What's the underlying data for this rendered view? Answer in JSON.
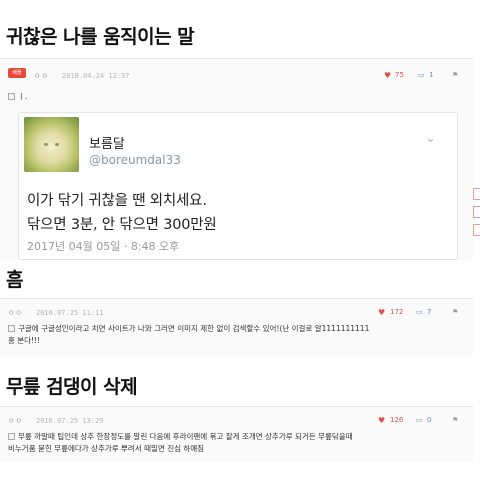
{
  "sections": [
    {
      "heading": "귀찮은 나를 움직이는 말",
      "badge": "베플",
      "date": "2018.04.24 12:37",
      "likes": "75",
      "replies": "1",
      "text": "ㅣ.",
      "tweet": {
        "name": "보름달",
        "handle": "@boreumdal33",
        "line1": "이가 닦기 귀찮을 땐 외치세요.",
        "line2": "닦으면 3분, 안 닦으면 300만원",
        "date": "2017년 04월 05일 · 8:48 오후"
      }
    },
    {
      "heading": "흠",
      "date": "2016.07.25 11:11",
      "likes": "172",
      "replies": "7",
      "text_line1": "구글에 구글성인이라고 치면 사이트가 나와 그러면 이미지 제한 없이 검색할수 있어!(난 이걸로 알1111111111",
      "text_line2": "홍 본다!!!"
    },
    {
      "heading": "무릎 검댕이 삭제",
      "date": "2016.07.25 13:29",
      "likes": "126",
      "replies": "0",
      "text_line1": "무릎 까말때 팁인데 상추 한장정도를 말린 다음에 후라이팬에 볶고 잘게 조개면 상추가루 되거든 무릎닦을때",
      "text_line2": "비누거품 묻힌 무릎에다가 상추가루 뿌려서 때밀면 진심 하얘짐"
    }
  ],
  "icons": {
    "dots": "ㅇㅇ",
    "thumb": "👍",
    "reply": "💬",
    "menu": "⋮",
    "chevron": "⌄"
  },
  "colors": {
    "accent_red": "#d9534f",
    "badge_red": "#e84b3c",
    "reply_blue": "#5b8bc9"
  }
}
